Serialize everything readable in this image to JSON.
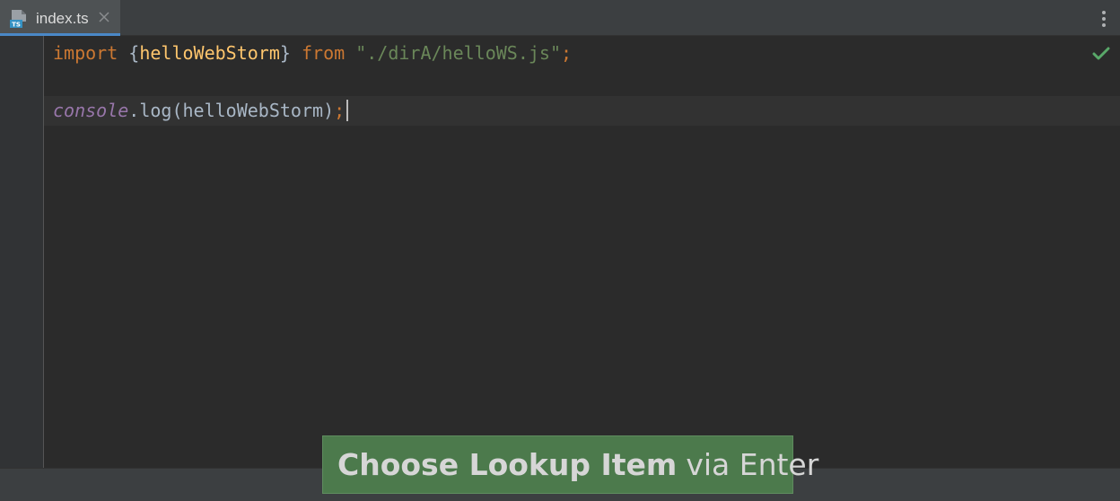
{
  "tab": {
    "label": "index.ts",
    "file_type_badge": "TS",
    "icon": "typescript-file-icon"
  },
  "editor": {
    "line1": {
      "kw_import": "import",
      "brace_open": "{",
      "ident": "helloWebStorm",
      "brace_close": "}",
      "kw_from": "from",
      "string": "\"./dirA/helloWS.js\"",
      "semi": ";"
    },
    "line3": {
      "object": "console",
      "dot": ".",
      "method": "log",
      "paren_open": "(",
      "arg": "helloWebStorm",
      "paren_close": ")",
      "semi": ";"
    },
    "status_icon": "check-icon"
  },
  "overlay": {
    "action": "Choose Lookup Item",
    "via": "via Enter"
  },
  "colors": {
    "keyword": "#cc7832",
    "identifier": "#ffc66d",
    "string": "#6a8759",
    "object": "#9876aa",
    "tab_underline": "#4a88c7",
    "overlay_bg": "#4c7a4c",
    "check": "#59a869"
  }
}
